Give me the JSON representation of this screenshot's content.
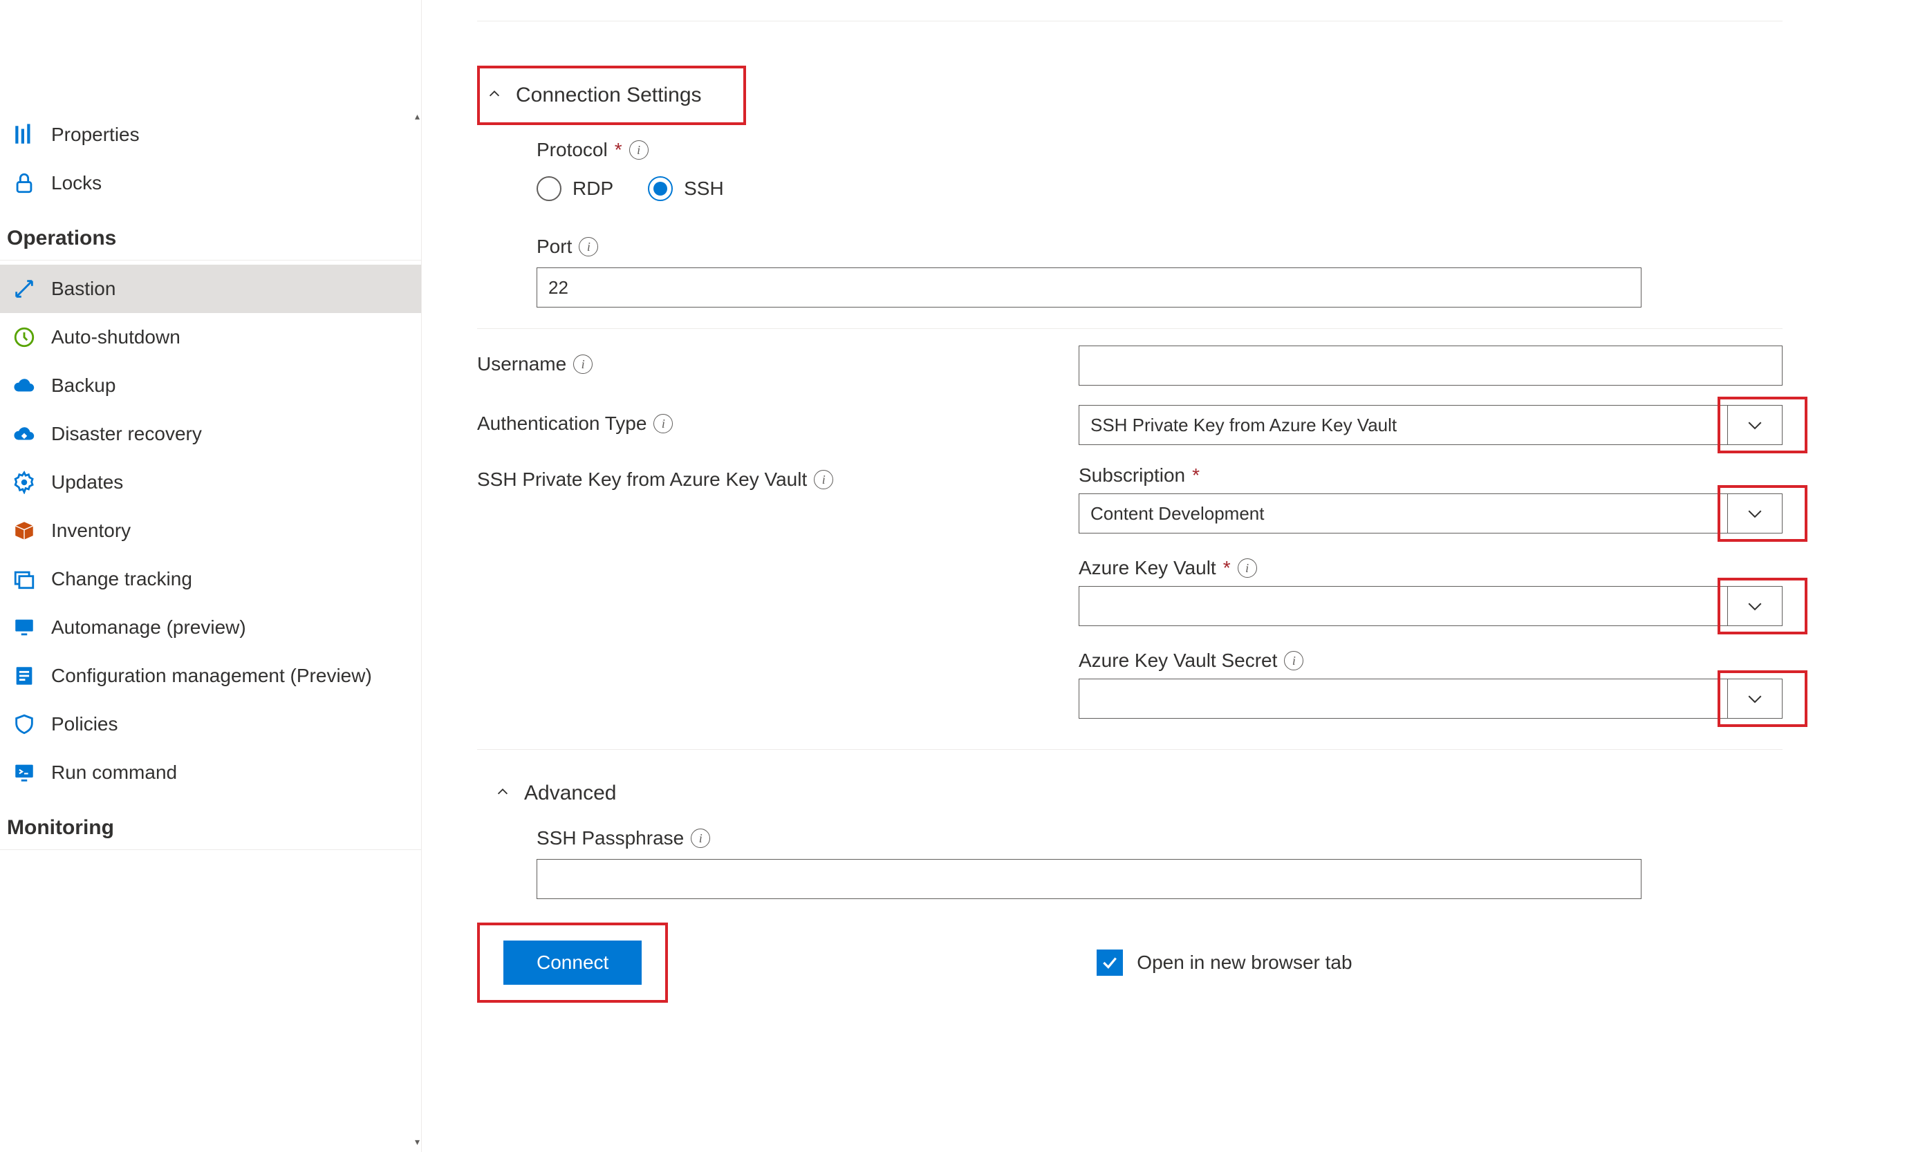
{
  "sidebar": {
    "items_settings": [
      {
        "label": "Properties",
        "icon": "properties"
      },
      {
        "label": "Locks",
        "icon": "lock"
      }
    ],
    "group_operations": "Operations",
    "items_operations": [
      {
        "label": "Bastion",
        "icon": "bastion",
        "selected": true
      },
      {
        "label": "Auto-shutdown",
        "icon": "clock"
      },
      {
        "label": "Backup",
        "icon": "cloud-backup"
      },
      {
        "label": "Disaster recovery",
        "icon": "cloud-recovery"
      },
      {
        "label": "Updates",
        "icon": "gear"
      },
      {
        "label": "Inventory",
        "icon": "box"
      },
      {
        "label": "Change tracking",
        "icon": "change"
      },
      {
        "label": "Automanage (preview)",
        "icon": "monitor-gear"
      },
      {
        "label": "Configuration management (Preview)",
        "icon": "config"
      },
      {
        "label": "Policies",
        "icon": "policy"
      },
      {
        "label": "Run command",
        "icon": "terminal"
      }
    ],
    "group_monitoring": "Monitoring"
  },
  "section_connection": {
    "title": "Connection Settings",
    "protocol_label": "Protocol",
    "protocol_options": {
      "rdp": "RDP",
      "ssh": "SSH"
    },
    "protocol_selected": "ssh",
    "port_label": "Port",
    "port_value": "22"
  },
  "fields": {
    "username_label": "Username",
    "username_value": "",
    "auth_type_label": "Authentication Type",
    "auth_type_value": "SSH Private Key from Azure Key Vault",
    "kv_section_label": "SSH Private Key from Azure Key Vault",
    "subscription_label": "Subscription",
    "subscription_value": "Content Development",
    "akv_label": "Azure Key Vault",
    "akv_value": "",
    "akv_secret_label": "Azure Key Vault Secret",
    "akv_secret_value": ""
  },
  "section_advanced": {
    "title": "Advanced",
    "ssh_passphrase_label": "SSH Passphrase",
    "ssh_passphrase_value": ""
  },
  "footer": {
    "connect_label": "Connect",
    "open_tab_label": "Open in new browser tab",
    "open_tab_checked": true
  }
}
